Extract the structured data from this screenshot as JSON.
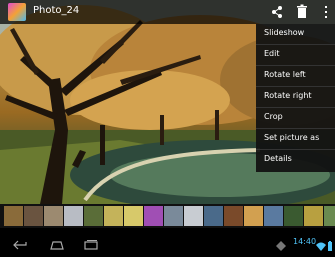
{
  "app": {
    "title": "Photo_24"
  },
  "actionbar": {
    "icons": [
      "share-icon",
      "delete-icon",
      "overflow-menu-icon"
    ]
  },
  "menu": {
    "items": [
      "Slideshow",
      "Edit",
      "Rotate left",
      "Rotate right",
      "Crop",
      "Set picture as",
      "Details"
    ]
  },
  "filmstrip": {
    "thumb_count": 17
  },
  "navbar": {
    "icons": [
      "back-icon",
      "home-icon",
      "recent-apps-icon"
    ]
  },
  "statusbar": {
    "time": "14:40",
    "icons": [
      "sync-icon",
      "wifi-icon",
      "battery-icon"
    ]
  },
  "colors": {
    "clock": "#4fc3f7",
    "menu_bg": "#121212",
    "actionbar_bg": "#000000"
  }
}
